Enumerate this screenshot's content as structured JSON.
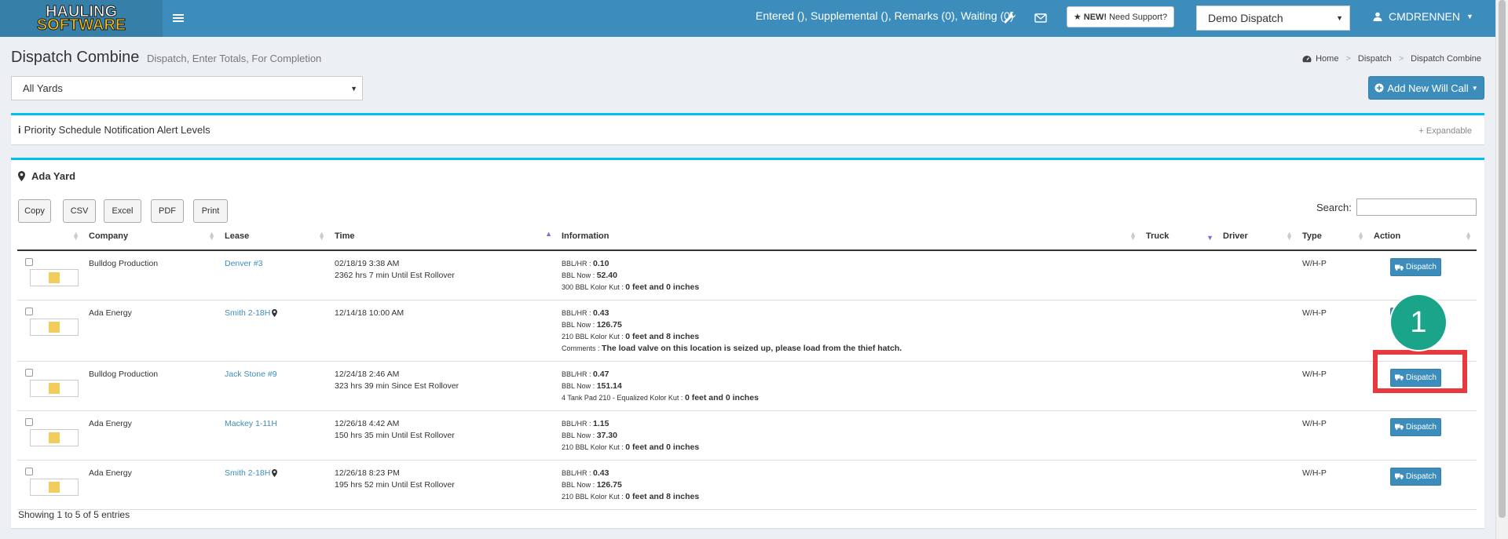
{
  "topbar": {
    "logo_line1": "HAULING",
    "logo_line2": "SOFTWARE",
    "status": "Entered (), Supplemental (), Remarks (0), Waiting (0)",
    "support_new": "NEW!",
    "support_label": "Need Support?",
    "dispatch_selected": "Demo Dispatch",
    "user": "CMDRENNEN",
    "icons": [
      "hamburger-icon",
      "wrench-icon",
      "envelope-icon",
      "star-icon",
      "user-icon",
      "caret-down-icon"
    ]
  },
  "header": {
    "title": "Dispatch Combine",
    "subtitle": "Dispatch, Enter Totals, For Completion",
    "breadcrumb": [
      "Home",
      "Dispatch",
      "Dispatch Combine"
    ],
    "yard_selected": "All Yards",
    "add_button": "Add New Will Call"
  },
  "priority_box": {
    "title": "Priority Schedule Notification Alert Levels",
    "expand_label": "Expandable"
  },
  "yard_box": {
    "title": "Ada Yard",
    "export_buttons": [
      "Copy",
      "CSV",
      "Excel",
      "PDF",
      "Print"
    ],
    "search_label": "Search:",
    "columns": [
      "",
      "Company",
      "Lease",
      "Time",
      "Information",
      "Truck",
      "Driver",
      "Type",
      "Action"
    ],
    "rows": [
      {
        "company": "Bulldog Production",
        "lease": "Denver #3",
        "time1": "02/18/19 3:38 AM",
        "time2": "2362 hrs 7 min Until Est Rollover",
        "info": [
          {
            "label": "BBL/HR :",
            "value": "0.10"
          },
          {
            "label": "BBL Now :",
            "value": "52.40"
          },
          {
            "label": "300 BBL Kolor Kut :",
            "value": "0 feet and 0 inches"
          }
        ],
        "type": "W/H-P",
        "action": "Dispatch"
      },
      {
        "company": "Ada Energy",
        "lease": "Smith 2-18H",
        "time1": "12/14/18 10:00 AM",
        "time2": "",
        "info": [
          {
            "label": "BBL/HR :",
            "value": "0.43"
          },
          {
            "label": "BBL Now :",
            "value": "126.75"
          },
          {
            "label": "210 BBL Kolor Kut :",
            "value": "0 feet and 8 inches"
          },
          {
            "label": "Comments :",
            "value": "The load valve on this location is seized up, please load from the thief hatch."
          }
        ],
        "type": "W/H-P",
        "action": "Dispatch"
      },
      {
        "company": "Bulldog Production",
        "lease": "Jack Stone #9",
        "time1": "12/24/18 2:46 AM",
        "time2": "323 hrs 39 min Since Est Rollover",
        "info": [
          {
            "label": "BBL/HR :",
            "value": "0.47"
          },
          {
            "label": "BBL Now :",
            "value": "151.14"
          },
          {
            "label": "4 Tank Pad 210 - Equalized Kolor Kut :",
            "value": "0 feet and 0 inches"
          }
        ],
        "type": "W/H-P",
        "action": "Dispatch"
      },
      {
        "company": "Ada Energy",
        "lease": "Mackey 1-11H",
        "time1": "12/26/18 4:42 AM",
        "time2": "150 hrs 35 min Until Est Rollover",
        "info": [
          {
            "label": "BBL/HR :",
            "value": "1.15"
          },
          {
            "label": "BBL Now :",
            "value": "37.30"
          },
          {
            "label": "210 BBL Kolor Kut :",
            "value": "0 feet and 0 inches"
          }
        ],
        "type": "W/H-P",
        "action": "Dispatch"
      },
      {
        "company": "Ada Energy",
        "lease": "Smith 2-18H",
        "time1": "12/26/18 8:23 PM",
        "time2": "195 hrs 52 min Until Est Rollover",
        "info": [
          {
            "label": "BBL/HR :",
            "value": "0.43"
          },
          {
            "label": "BBL Now :",
            "value": "126.75"
          },
          {
            "label": "210 BBL Kolor Kut :",
            "value": "0 feet and 8 inches"
          }
        ],
        "type": "W/H-P",
        "action": "Dispatch"
      }
    ],
    "footer": "Showing 1 to 5 of 5 entries"
  },
  "annotation": {
    "step": "1"
  },
  "colors": {
    "topbar": "#3c8dbc",
    "box_accent": "#00c0ef",
    "highlight": "#e8393f",
    "step_circle": "#1aa48a",
    "swatch": "#f2cc5c"
  }
}
